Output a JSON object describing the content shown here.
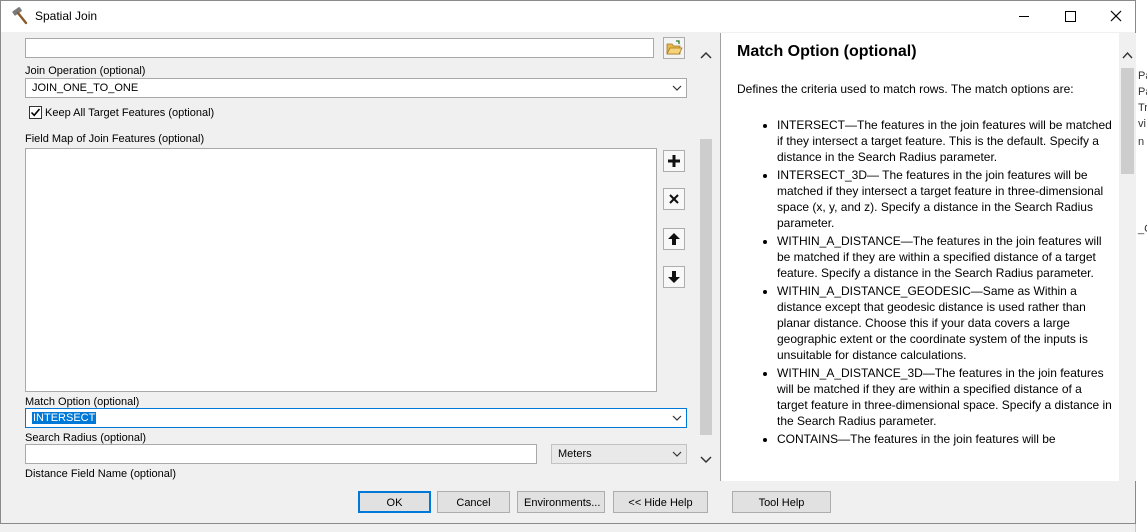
{
  "window": {
    "title": "Spatial Join"
  },
  "background_letters": [
    "Pa",
    "Pa",
    "Tr",
    "vi",
    "n",
    "_C"
  ],
  "params": {
    "top_field_value": "",
    "join_operation_label": "Join Operation (optional)",
    "join_operation_value": "JOIN_ONE_TO_ONE",
    "keep_all_label": "Keep All Target Features (optional)",
    "keep_all_checked": true,
    "field_map_label": "Field Map of Join Features (optional)",
    "match_option_label": "Match Option (optional)",
    "match_option_value": "INTERSECT",
    "search_radius_label": "Search Radius (optional)",
    "search_radius_value": "",
    "search_radius_unit": "Meters",
    "distance_field_label": "Distance Field Name (optional)"
  },
  "help": {
    "title": "Match Option (optional)",
    "intro": "Defines the criteria used to match rows. The match options are:",
    "items": [
      "INTERSECT—The features in the join features will be matched if they intersect a target feature. This is the default. Specify a distance in the Search Radius parameter.",
      "INTERSECT_3D— The features in the join features will be matched if they intersect a target feature in three-dimensional space (x, y, and z). Specify a distance in the Search Radius parameter.",
      "WITHIN_A_DISTANCE—The features in the join features will be matched if they are within a specified distance of a target feature. Specify a distance in the Search Radius parameter.",
      "WITHIN_A_DISTANCE_GEODESIC—Same as Within a distance except that geodesic distance is used rather than planar distance. Choose this if your data covers a large geographic extent or the coordinate system of the inputs is unsuitable for distance calculations.",
      "WITHIN_A_DISTANCE_3D—The features in the join features will be matched if they are within a specified distance of a target feature in three-dimensional space. Specify a distance in the Search Radius parameter.",
      "CONTAINS—The features in the join features will be"
    ]
  },
  "buttons": {
    "ok": "OK",
    "cancel": "Cancel",
    "environments": "Environments...",
    "hide_help": "<< Hide Help",
    "tool_help": "Tool Help"
  },
  "colors": {
    "accent": "#0078d7"
  }
}
